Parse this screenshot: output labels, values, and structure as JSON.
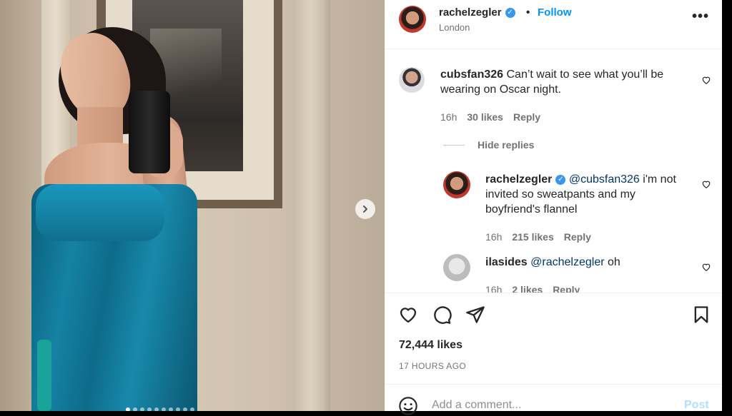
{
  "post": {
    "author": "rachelzegler",
    "follow_label": "Follow",
    "separator": "•",
    "location": "London",
    "more_label": "•••"
  },
  "comments": [
    {
      "user": "cubsfan326",
      "text": "Can’t wait to see what you’ll be wearing on Oscar night.",
      "time": "16h",
      "likes": "30 likes",
      "reply_label": "Reply"
    }
  ],
  "hide_replies_label": "Hide replies",
  "replies": [
    {
      "user": "rachelzegler",
      "mention": "@cubsfan326",
      "text_line1": "i'm not",
      "text_line2": "invited so sweatpants and my",
      "text_line3": "boyfriend's flannel",
      "time": "16h",
      "likes": "215 likes",
      "reply_label": "Reply"
    },
    {
      "user": "ilasides",
      "mention": "@rachelzegler",
      "text": "oh",
      "time": "16h",
      "likes": "2 likes",
      "reply_label": "Reply"
    }
  ],
  "stats": {
    "likes": "72,444 likes",
    "timestamp": "17 HOURS AGO"
  },
  "add_comment": {
    "placeholder": "Add a comment...",
    "post_label": "Post"
  },
  "icons": {
    "like": "heart-icon",
    "comment": "comment-bubble-icon",
    "share": "paper-plane-icon",
    "save": "bookmark-icon",
    "emoji": "emoji-smile-icon",
    "next": "chevron-right-icon",
    "verified": "verified-badge-icon"
  },
  "colors": {
    "accent": "#0095f6",
    "verified": "#3897f0",
    "mention": "#00376b",
    "muted": "#737373"
  }
}
